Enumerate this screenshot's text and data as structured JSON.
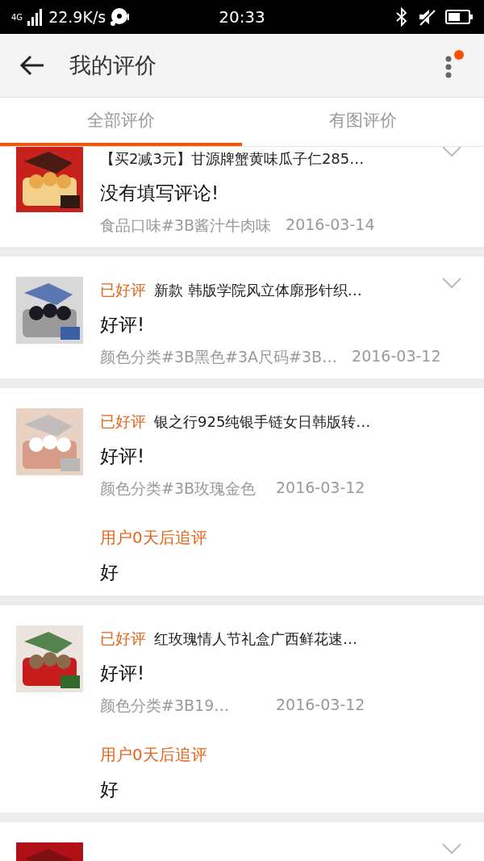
{
  "status_bar": {
    "network": "4G",
    "speed": "22.9K/s",
    "time": "20:33"
  },
  "header": {
    "title": "我的评价",
    "has_notification": true
  },
  "tabs": [
    {
      "label": "全部评价",
      "selected": true
    },
    {
      "label": "有图评价",
      "selected": false
    }
  ],
  "reviews": [
    {
      "title": "【买2减3元】甘源牌蟹黄味瓜子仁285…",
      "comment": "没有填写评论!",
      "sku": "食品口味#3B酱汁牛肉味",
      "date": "2016-03-14",
      "expandable": true
    },
    {
      "rating": "已好评",
      "title": "新款 韩版学院风立体廓形针织…",
      "comment": "好评!",
      "sku": "颜色分类#3B黑色#3A尺码#3B…",
      "date": "2016-03-12",
      "expandable": true
    },
    {
      "rating": "已好评",
      "title": "银之行925纯银手链女日韩版转…",
      "comment": "好评!",
      "sku": "颜色分类#3B玫瑰金色",
      "date": "2016-03-12",
      "expandable": false,
      "followup": {
        "label": "用户0天后追评",
        "text": "好"
      }
    },
    {
      "rating": "已好评",
      "title": "红玫瑰情人节礼盒广西鲜花速…",
      "comment": "好评!",
      "sku": "颜色分类#3B19…",
      "date": "2016-03-12",
      "expandable": false,
      "followup": {
        "label": "用户0天后追评",
        "text": "好"
      }
    },
    {
      "expandable": true
    }
  ]
}
